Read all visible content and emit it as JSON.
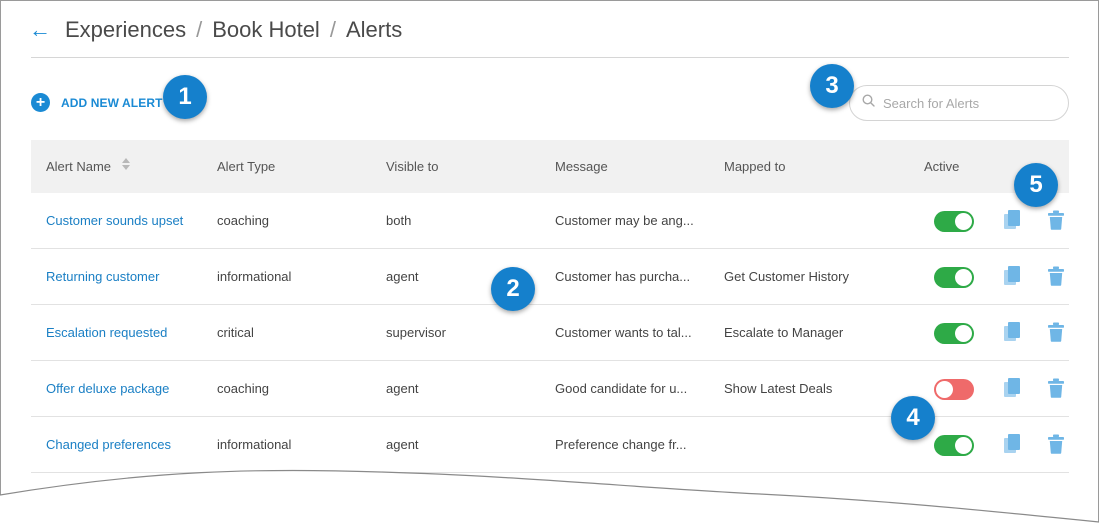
{
  "breadcrumb": {
    "items": [
      "Experiences",
      "Book Hotel",
      "Alerts"
    ],
    "separator": "/"
  },
  "toolbar": {
    "add_label": "ADD NEW ALERT"
  },
  "search": {
    "placeholder": "Search for Alerts",
    "value": ""
  },
  "table": {
    "columns": [
      "Alert Name",
      "Alert Type",
      "Visible to",
      "Message",
      "Mapped to",
      "Active"
    ],
    "rows": [
      {
        "name": "Customer sounds upset",
        "type": "coaching",
        "visible": "both",
        "message": "Customer may be ang...",
        "mapped": "",
        "active": true
      },
      {
        "name": "Returning customer",
        "type": "informational",
        "visible": "agent",
        "message": "Customer has purcha...",
        "mapped": "Get Customer History",
        "active": true
      },
      {
        "name": "Escalation requested",
        "type": "critical",
        "visible": "supervisor",
        "message": "Customer wants to tal...",
        "mapped": "Escalate to Manager",
        "active": true
      },
      {
        "name": "Offer deluxe package",
        "type": "coaching",
        "visible": "agent",
        "message": "Good candidate for u...",
        "mapped": "Show Latest Deals",
        "active": false
      },
      {
        "name": "Changed preferences",
        "type": "informational",
        "visible": "agent",
        "message": "Preference change fr...",
        "mapped": "",
        "active": true
      }
    ]
  },
  "callouts": [
    "1",
    "2",
    "3",
    "4",
    "5"
  ],
  "icons": {
    "back": "arrow-left-icon",
    "add": "plus-circle-icon",
    "search": "search-icon",
    "sort": "sort-icon",
    "copy": "copy-icon",
    "delete": "trash-icon"
  },
  "colors": {
    "accent": "#1a8ad4",
    "toggle_on": "#2eaa47",
    "toggle_off": "#ef6a6a",
    "callout": "#1580cc",
    "action_icon": "#7fbde8"
  }
}
